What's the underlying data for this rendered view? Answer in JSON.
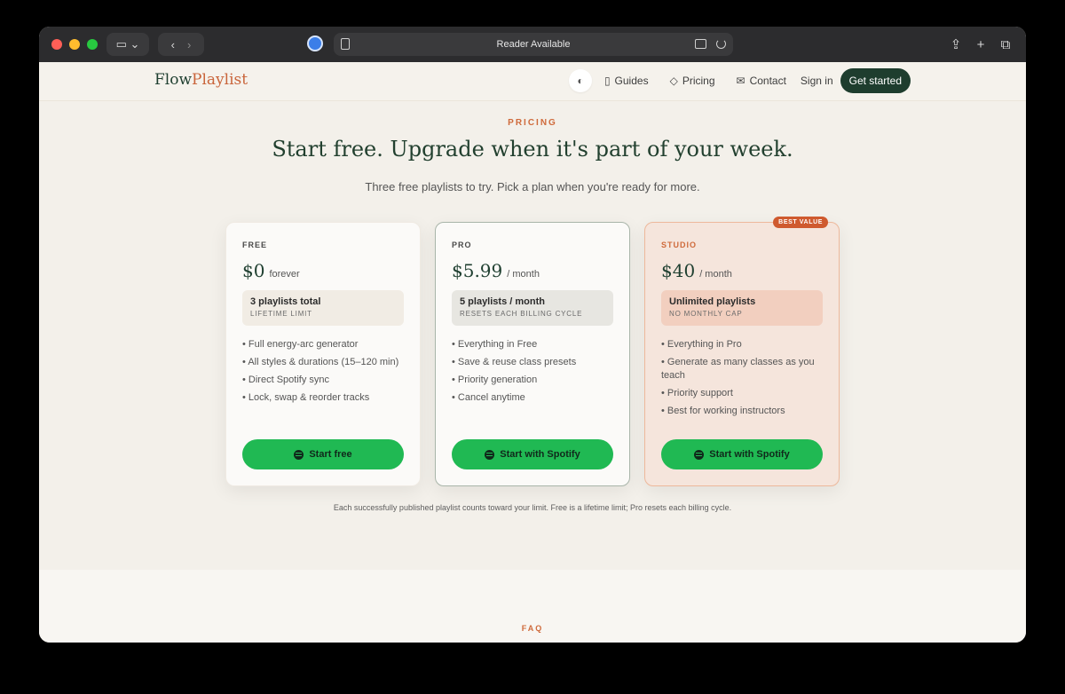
{
  "browser": {
    "address_text": "Reader Available",
    "colors": {
      "chrome": "#2c2c2e"
    }
  },
  "nav": {
    "logo_part1": "Flow",
    "logo_part2": "Playlist",
    "links": [
      {
        "label": "Guides",
        "icon": "book-icon"
      },
      {
        "label": "Pricing",
        "icon": "tag-icon"
      },
      {
        "label": "Contact",
        "icon": "mail-icon"
      }
    ],
    "sign_in": "Sign in",
    "cta": "Get started"
  },
  "hero": {
    "eyebrow": "PRICING",
    "headline": "Start free. Upgrade when it's part of your week.",
    "sub": "Three free playlists to try. Pick a plan when you're ready for more."
  },
  "plans": [
    {
      "name": "FREE",
      "price": "$0",
      "period": "forever",
      "limit_title": "3 playlists total",
      "limit_sub": "LIFETIME LIMIT",
      "features": [
        "Full energy-arc generator",
        "All styles & durations (15–120 min)",
        "Direct Spotify sync",
        "Lock, swap & reorder tracks"
      ],
      "button": "Start free"
    },
    {
      "name": "PRO",
      "price": "$5.99",
      "period": "/ month",
      "limit_title": "5 playlists / month",
      "limit_sub": "RESETS EACH BILLING CYCLE",
      "features": [
        "Everything in Free",
        "Save & reuse class presets",
        "Priority generation",
        "Cancel anytime"
      ],
      "button": "Start with Spotify"
    },
    {
      "name": "STUDIO",
      "badge": "BEST VALUE",
      "price": "$40",
      "period": "/ month",
      "limit_title": "Unlimited playlists",
      "limit_sub": "NO MONTHLY CAP",
      "features": [
        "Everything in Pro",
        "Generate as many classes as you teach",
        "Priority support",
        "Best for working instructors"
      ],
      "button": "Start with Spotify"
    }
  ],
  "footnote": "Each successfully published playlist counts toward your limit. Free is a lifetime limit; Pro resets each billing cycle.",
  "faq_label": "FAQ",
  "colors": {
    "accent": "#cf6a3b",
    "brand_green": "#1e3d2e",
    "spotify_green": "#20b953"
  }
}
